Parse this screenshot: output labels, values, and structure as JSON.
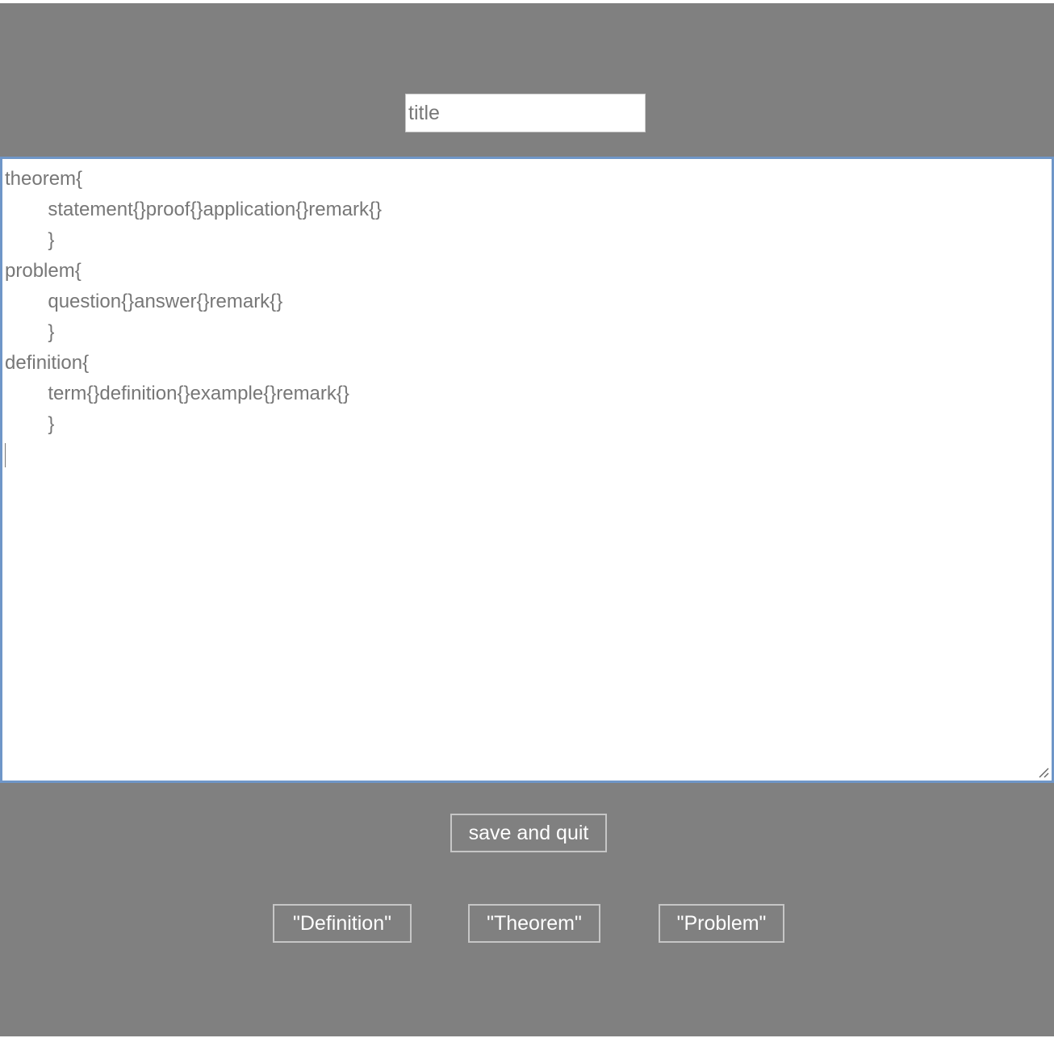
{
  "title_field": {
    "placeholder": "title",
    "value": ""
  },
  "editor": {
    "lines": [
      {
        "indent": false,
        "text": "theorem{"
      },
      {
        "indent": true,
        "text": "statement{}proof{}application{}remark{}"
      },
      {
        "indent": true,
        "text": "}"
      },
      {
        "indent": false,
        "text": "problem{"
      },
      {
        "indent": true,
        "text": "question{}answer{}remark{}"
      },
      {
        "indent": true,
        "text": "}"
      },
      {
        "indent": false,
        "text": "definition{"
      },
      {
        "indent": true,
        "text": "term{}definition{}example{}remark{}"
      },
      {
        "indent": true,
        "text": "}"
      }
    ]
  },
  "buttons": {
    "save_and_quit": "save and quit",
    "definition": "\"Definition\"",
    "theorem": "\"Theorem\"",
    "problem": "\"Problem\""
  },
  "colors": {
    "background": "#808080",
    "editor_focus_border": "#6f96c8",
    "text": "#777777",
    "button_text": "#ffffff",
    "button_border": "#c6c6c6"
  },
  "icons": {
    "resize_handle": "resize-grip-icon"
  }
}
